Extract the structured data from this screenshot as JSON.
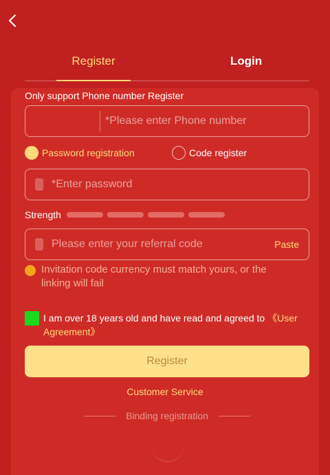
{
  "tabs": {
    "register": "Register",
    "login": "Login"
  },
  "phone_section": {
    "label": "Only support Phone number Register",
    "placeholder": "*Please enter Phone number"
  },
  "registration_modes": {
    "password": "Password registration",
    "code": "Code register",
    "selected": "password"
  },
  "password": {
    "placeholder": "*Enter password"
  },
  "strength": {
    "label": "Strength",
    "segments": 4
  },
  "referral": {
    "placeholder": "Please enter your referral code",
    "paste_label": "Paste",
    "notice": "Invitation code currency must match yours, or the linking will fail"
  },
  "agreement": {
    "text": "I am over 18 years old and have read and agreed to ",
    "link": "《User Agreement》",
    "checked": true
  },
  "register_button": "Register",
  "customer_service": "Customer Service",
  "binding_registration": "Binding registration",
  "colors": {
    "background": "#c0201f",
    "panel": "#cf2b26",
    "accent": "#ffd97a",
    "button": "#ffe08a",
    "checkbox": "#19d81f",
    "notice_dot": "#f4a41c"
  }
}
